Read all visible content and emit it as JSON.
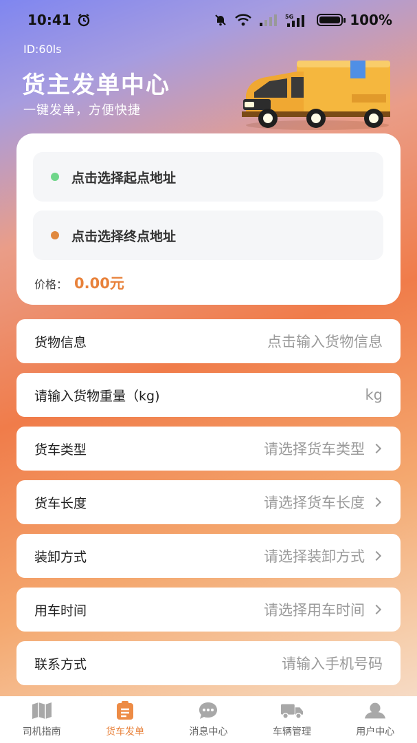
{
  "status_bar": {
    "time": "10:41",
    "battery": "100%"
  },
  "header": {
    "user_id": "ID:60ls",
    "title": "货主发单中心",
    "subtitle": "一键发单，方便快捷"
  },
  "address": {
    "start_placeholder": "点击选择起点地址",
    "end_placeholder": "点击选择终点地址",
    "price_label": "价格：",
    "price_value": "0.00元"
  },
  "form": {
    "cargo_info": {
      "label": "货物信息",
      "placeholder": "点击输入货物信息"
    },
    "cargo_weight": {
      "label": "请输入货物重量（kg)",
      "unit": "kg"
    },
    "truck_type": {
      "label": "货车类型",
      "placeholder": "请选择货车类型"
    },
    "truck_length": {
      "label": "货车长度",
      "placeholder": "请选择货车长度"
    },
    "loading_method": {
      "label": "装卸方式",
      "placeholder": "请选择装卸方式"
    },
    "use_time": {
      "label": "用车时间",
      "placeholder": "请选择用车时间"
    },
    "contact": {
      "label": "联系方式",
      "placeholder": "请输入手机号码"
    }
  },
  "tabs": [
    {
      "label": "司机指南",
      "icon": "map-icon",
      "active": false
    },
    {
      "label": "货车发单",
      "icon": "clipboard-icon",
      "active": true
    },
    {
      "label": "消息中心",
      "icon": "chat-icon",
      "active": false
    },
    {
      "label": "车辆管理",
      "icon": "truck-icon",
      "active": false
    },
    {
      "label": "用户中心",
      "icon": "user-icon",
      "active": false
    }
  ],
  "colors": {
    "accent": "#e8813a",
    "start_dot": "#6fd68a",
    "end_dot": "#e0893f"
  }
}
